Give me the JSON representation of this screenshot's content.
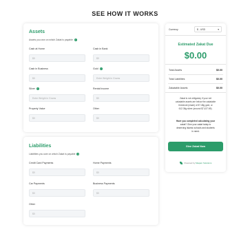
{
  "page_title": "SEE HOW IT WORKS",
  "assets": {
    "title": "Assets",
    "description": "Assets you own on which Zakat is payable",
    "fields": [
      {
        "label": "Cash at Home",
        "placeholder": "$0",
        "info": false
      },
      {
        "label": "Cash in Bank",
        "placeholder": "$0",
        "info": false
      },
      {
        "label": "Cash in Business",
        "placeholder": "$0",
        "info": false
      },
      {
        "label": "Gold",
        "placeholder": "Enter Weight in Grams",
        "info": true
      },
      {
        "label": "Silver",
        "placeholder": "Enter Weight in Grams",
        "info": true
      },
      {
        "label": "Rental Income",
        "placeholder": "$0",
        "info": false
      },
      {
        "label": "Property Value",
        "placeholder": "$0",
        "info": false
      },
      {
        "label": "Other",
        "placeholder": "$0",
        "info": false
      }
    ]
  },
  "liabilities": {
    "title": "Liabilities",
    "description": "Liabilities you owe on which Zakat is payable",
    "fields": [
      {
        "label": "Credit Card Payments",
        "placeholder": "$0"
      },
      {
        "label": "Home Payments",
        "placeholder": "$0"
      },
      {
        "label": "Car Payments",
        "placeholder": "$0"
      },
      {
        "label": "Business Payments",
        "placeholder": "$0"
      },
      {
        "label": "Other",
        "placeholder": "$0"
      }
    ]
  },
  "summary": {
    "currency_label": "Currency",
    "currency_value": "$ - USD",
    "estimate_title": "Estimated Zakat Due",
    "amount": "$0.00",
    "rows": [
      {
        "label": "Total Assets",
        "value": "$0.00"
      },
      {
        "label": "Total Liabilities",
        "value": "$0.00"
      },
      {
        "label": "Zakatable Assets",
        "value": "$0.00"
      }
    ],
    "note_line1": "Zakat is not obligatory if your net",
    "note_line2": "zakatable assets are below the zakatable",
    "note_line3": "threshold (nisab) of 87.48g gold, or",
    "note_line4": "612.36g silver (around $7,437.69).",
    "cta_line1": "Have you completed calculating your",
    "cta_line2": "zakat? Give your zakat today to",
    "cta_line3": "deserving Islamic schools and students",
    "cta_line4": "in need.",
    "button_label": "Give Zakat Now",
    "powered_by": "Powered by",
    "brand": "Maqam Solutions"
  },
  "colors": {
    "accent": "#2c9c6a",
    "input_bg": "#f3f5f7"
  },
  "icons": {
    "info": "info-icon",
    "chevron": "chevron-down-icon",
    "brand_logo": "leaf-logo-icon"
  }
}
